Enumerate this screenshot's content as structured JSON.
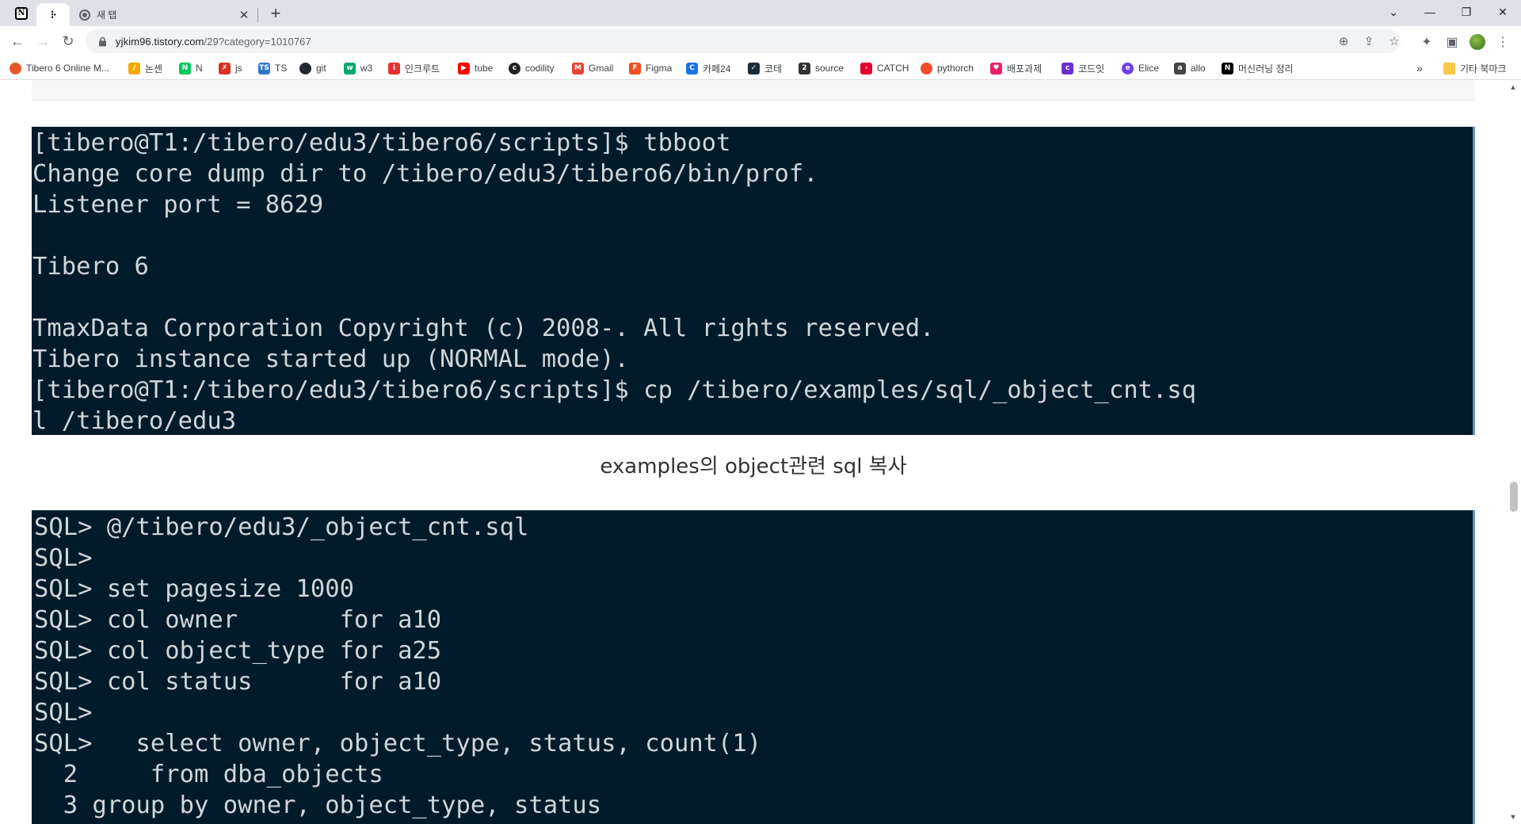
{
  "browser": {
    "tabs": [
      {
        "label": "",
        "icon": "notion-icon"
      },
      {
        "label": "",
        "icon": "tistory-icon"
      },
      {
        "label": "새 탭",
        "icon": "chrome-icon"
      }
    ],
    "url": {
      "host": "yjkim96.tistory.com",
      "path": "/29?category=1010767"
    },
    "bookmarks": [
      {
        "label": "Tibero 6 Online M...",
        "color": "#e8572c"
      },
      {
        "label": "논센",
        "color": "#f2a900"
      },
      {
        "label": "N",
        "color": "#03c75a"
      },
      {
        "label": "js",
        "color": "#d93025"
      },
      {
        "label": "TS",
        "color": "#3178c6"
      },
      {
        "label": "git",
        "color": "#24292f"
      },
      {
        "label": "w3",
        "color": "#04aa6d"
      },
      {
        "label": "인크루트",
        "color": "#e6312e"
      },
      {
        "label": "tube",
        "color": "#ff0000"
      },
      {
        "label": "codility",
        "color": "#222222"
      },
      {
        "label": "Gmail",
        "color": "#ea4335"
      },
      {
        "label": "Figma",
        "color": "#f24e1e"
      },
      {
        "label": "카페24",
        "color": "#1a73e8"
      },
      {
        "label": "코테",
        "color": "#1e2a38"
      },
      {
        "label": "source",
        "color": "#333333"
      },
      {
        "label": "CATCH",
        "color": "#e4002b"
      },
      {
        "label": "pythorch",
        "color": "#ee4c2c"
      },
      {
        "label": "배포과제",
        "color": "#e91e63"
      },
      {
        "label": "코드잇",
        "color": "#6a2fd8"
      },
      {
        "label": "Elice",
        "color": "#6c3ee8"
      },
      {
        "label": "allo",
        "color": "#444444"
      },
      {
        "label": "머신러닝 정리",
        "color": "#000000"
      }
    ],
    "bookmarks_overflow": "»",
    "other_bookmarks": "기타 북마크"
  },
  "content": {
    "terminal1": [
      "[tibero@T1:/tibero/edu3/tibero6/scripts]$ tbboot",
      "Change core dump dir to /tibero/edu3/tibero6/bin/prof.",
      "Listener port = 8629",
      "",
      "Tibero 6",
      "",
      "TmaxData Corporation Copyright (c) 2008-. All rights reserved.",
      "Tibero instance started up (NORMAL mode).",
      "[tibero@T1:/tibero/edu3/tibero6/scripts]$ cp /tibero/examples/sql/_object_cnt.sq",
      "l /tibero/edu3"
    ],
    "caption": "examples의 object관련 sql 복사",
    "terminal2": [
      "SQL> @/tibero/edu3/_object_cnt.sql",
      "SQL>",
      "SQL> set pagesize 1000",
      "SQL> col owner       for a10",
      "SQL> col object_type for a25",
      "SQL> col status      for a10",
      "SQL>",
      "SQL>   select owner, object_type, status, count(1)",
      "  2     from dba_objects",
      "  3 group by owner, object_type, status"
    ]
  }
}
